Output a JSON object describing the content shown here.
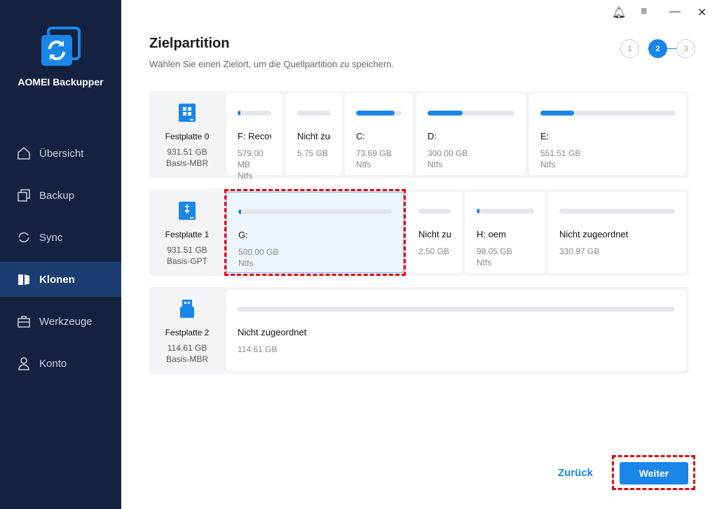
{
  "app": {
    "name": "AOMEI Backupper"
  },
  "nav": [
    {
      "label": "Übersicht"
    },
    {
      "label": "Backup"
    },
    {
      "label": "Sync"
    },
    {
      "label": "Klonen"
    },
    {
      "label": "Werkzeuge"
    },
    {
      "label": "Konto"
    }
  ],
  "header": {
    "title": "Zielpartition",
    "subtitle": "Wählen Sie einen Zielort, um die Quellpartition zu speichern."
  },
  "steps": [
    "1",
    "2",
    "3"
  ],
  "disks": [
    {
      "name": "Festplatte 0",
      "size": "931.51 GB",
      "type": "Basis-MBR",
      "partitions": [
        {
          "label": "F: Recovery",
          "size": "579.00 MB",
          "fs": "Ntfs",
          "used": 2
        },
        {
          "label": "Nicht zug...",
          "size": "5.75 GB",
          "fs": "",
          "used": 0
        },
        {
          "label": "C:",
          "size": "73.69 GB",
          "fs": "Ntfs",
          "used": 85
        },
        {
          "label": "D:",
          "size": "300.00 GB",
          "fs": "Ntfs",
          "used": 40
        },
        {
          "label": "E:",
          "size": "551.51 GB",
          "fs": "Ntfs",
          "used": 25
        }
      ]
    },
    {
      "name": "Festplatte 1",
      "size": "931.51 GB",
      "type": "Basis-GPT",
      "partitions": [
        {
          "label": "G:",
          "size": "500.00 GB",
          "fs": "Ntfs",
          "used": 1
        },
        {
          "label": "Nicht zu...",
          "size": "2.50 GB",
          "fs": "",
          "used": 0
        },
        {
          "label": "H: oem",
          "size": "98.05 GB",
          "fs": "Ntfs",
          "used": 4
        },
        {
          "label": "Nicht zugeordnet",
          "size": "330.97 GB",
          "fs": "",
          "used": 0
        }
      ]
    },
    {
      "name": "Festplatte 2",
      "size": "114.61 GB",
      "type": "Basis-MBR",
      "partitions": [
        {
          "label": "Nicht zugeordnet",
          "size": "114.61 GB",
          "fs": "",
          "used": 0
        }
      ]
    }
  ],
  "footer": {
    "back": "Zurück",
    "next": "Weiter"
  }
}
